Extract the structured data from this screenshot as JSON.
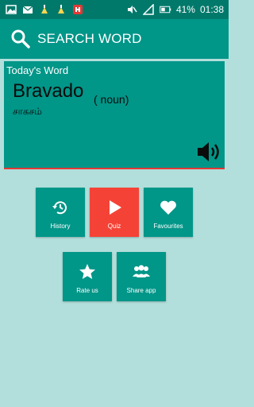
{
  "status_bar": {
    "battery_percent_label": "41%",
    "time": "01:38",
    "icons": [
      "image-icon",
      "mail-icon",
      "cleaner-icon",
      "cleaner-icon",
      "app-icon",
      "mute-icon",
      "signal-icon",
      "battery-icon"
    ]
  },
  "app_bar": {
    "title": "SEARCH WORD",
    "icon": "search-icon"
  },
  "word_card": {
    "label": "Today's Word",
    "word": "Bravado",
    "part_of_speech": "( noun)",
    "translation": "சாகசம்",
    "accent_color": "#e53935"
  },
  "tiles": {
    "history": {
      "label": "History",
      "icon": "history-icon"
    },
    "quiz": {
      "label": "Quiz",
      "icon": "play-icon"
    },
    "favourites": {
      "label": "Favourites",
      "icon": "heart-icon"
    },
    "rate": {
      "label": "Rate us",
      "icon": "star-icon"
    },
    "share": {
      "label": "Share app",
      "icon": "group-icon"
    }
  },
  "colors": {
    "primary": "#009688",
    "primary_dark": "#00796b",
    "background": "#b2dfdb",
    "quiz": "#f44336"
  }
}
